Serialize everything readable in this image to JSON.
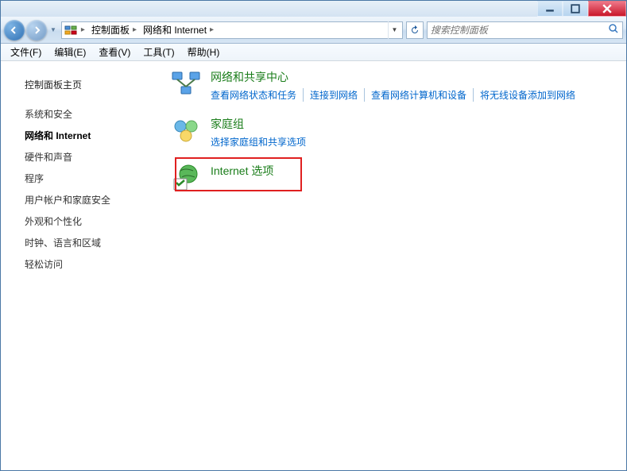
{
  "breadcrumb": {
    "root": "控制面板",
    "current": "网络和 Internet"
  },
  "search": {
    "placeholder": "搜索控制面板"
  },
  "menubar": [
    "文件(F)",
    "编辑(E)",
    "查看(V)",
    "工具(T)",
    "帮助(H)"
  ],
  "sidebar": {
    "home": "控制面板主页",
    "items": [
      "系统和安全",
      "网络和 Internet",
      "硬件和声音",
      "程序",
      "用户帐户和家庭安全",
      "外观和个性化",
      "时钟、语言和区域",
      "轻松访问"
    ],
    "activeIndex": 1
  },
  "categories": [
    {
      "title": "网络和共享中心",
      "links": [
        "查看网络状态和任务",
        "连接到网络",
        "查看网络计算机和设备",
        "将无线设备添加到网络"
      ]
    },
    {
      "title": "家庭组",
      "links": [
        "选择家庭组和共享选项"
      ]
    },
    {
      "title": "Internet 选项",
      "links": []
    }
  ]
}
